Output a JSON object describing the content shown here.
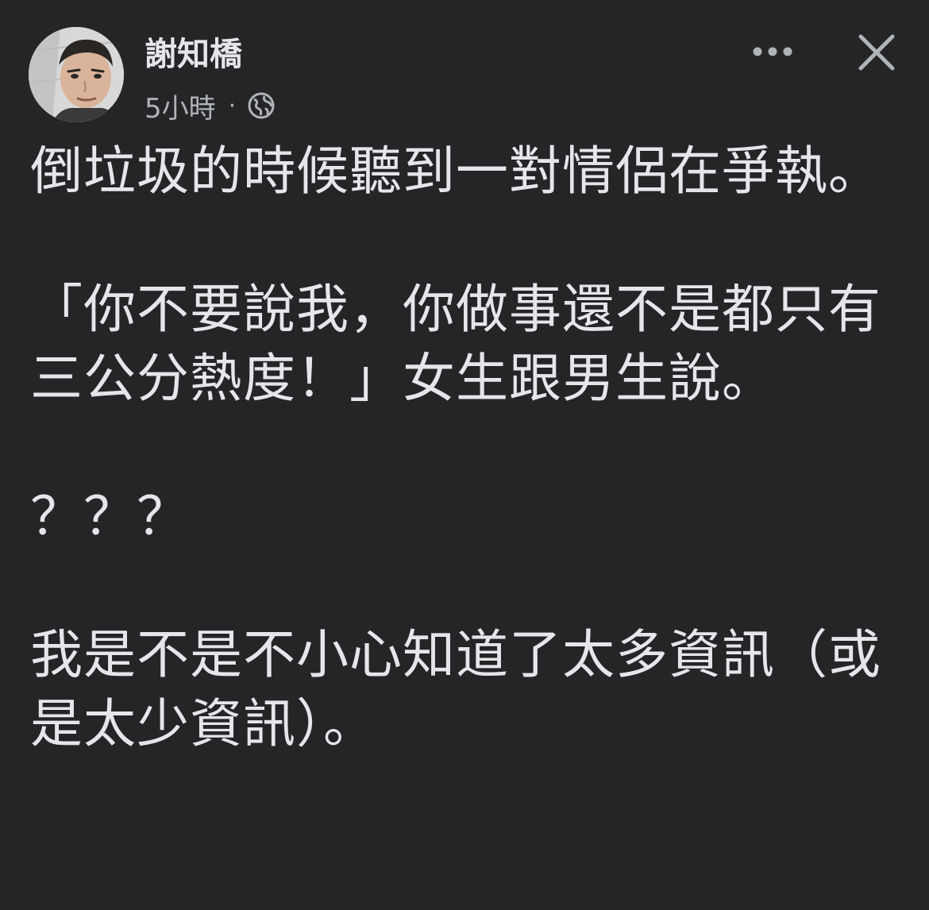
{
  "post": {
    "author": "謝知橋",
    "time": "5小時",
    "separator": "·",
    "privacy_icon": "globe-icon",
    "actions": {
      "more_icon": "more-horizontal-icon",
      "close_icon": "close-icon"
    },
    "paragraphs": [
      "倒垃圾的時候聽到一對情侶在爭執。",
      "「你不要說我，你做事還不是都只有三公分熱度！」女生跟男生說。",
      "？？？",
      "我是不是不小心知道了太多資訊（或是太少資訊）。"
    ]
  },
  "colors": {
    "background": "#242526",
    "text_primary": "#e4e6eb",
    "text_secondary": "#b0b3b8"
  }
}
